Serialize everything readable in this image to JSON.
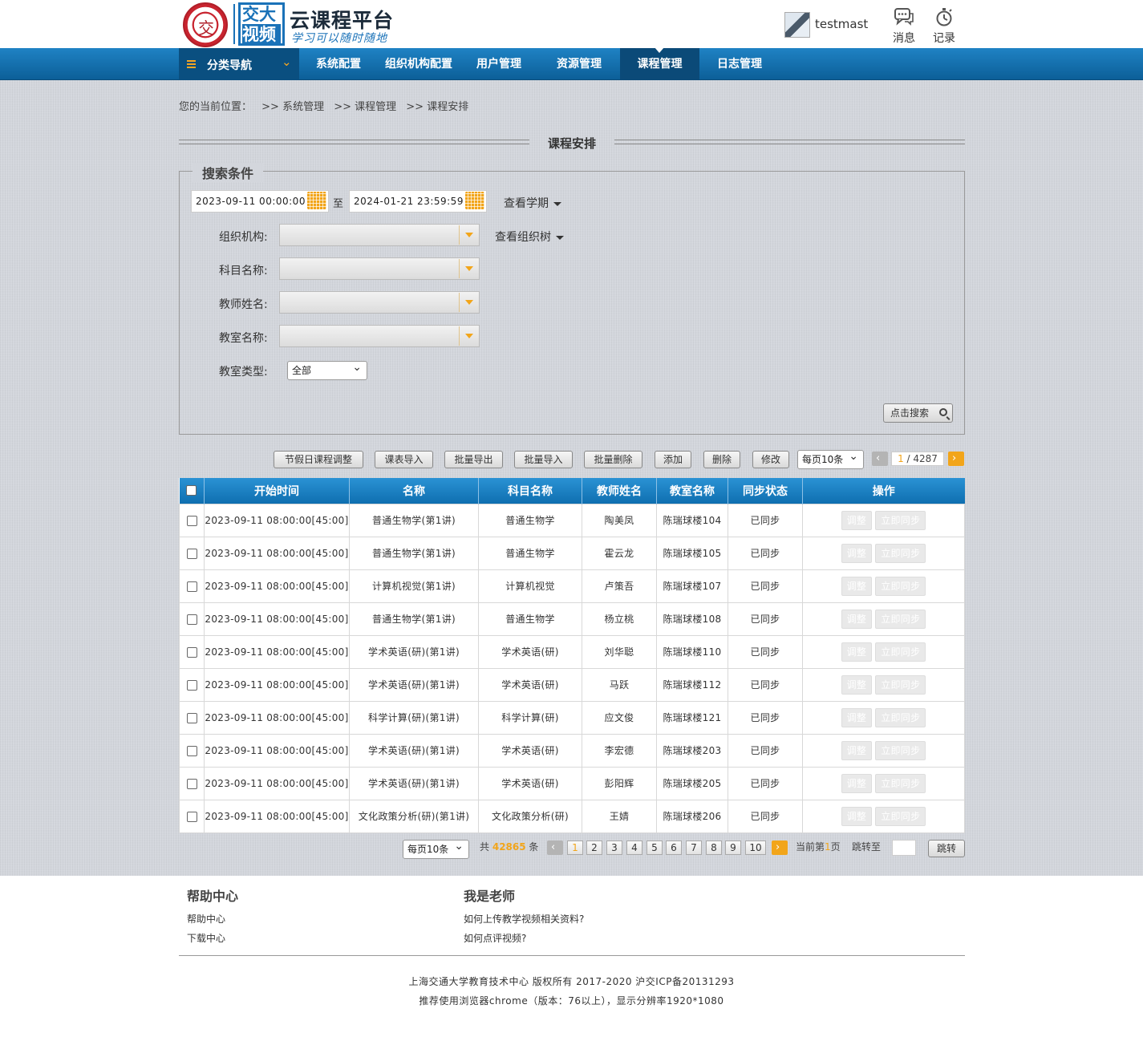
{
  "header": {
    "seal_glyph": "交",
    "logo_top": "交大",
    "logo_bottom": "视频",
    "title": "云课程平台",
    "subtitle": "学习可以随时随地",
    "username": "testmast",
    "messages_label": "消息",
    "records_label": "记录"
  },
  "nav": {
    "category_label": "分类导航",
    "items": [
      {
        "label": "系统配置"
      },
      {
        "label": "组织机构配置"
      },
      {
        "label": "用户管理"
      },
      {
        "label": "资源管理"
      },
      {
        "label": "课程管理",
        "active": true
      },
      {
        "label": "日志管理"
      }
    ]
  },
  "breadcrumb": {
    "prefix": "您的当前位置：",
    "items": [
      ">> 系统管理",
      ">> 课程管理",
      ">> 课程安排"
    ]
  },
  "page_title": "课程安排",
  "search": {
    "legend": "搜索条件",
    "start_date": "2023-09-11 00:00:00",
    "to_label": "至",
    "end_date": "2024-01-21 23:59:59",
    "view_term": "查看学期",
    "view_org_tree": "查看组织树",
    "org_label": "组织机构:",
    "subject_label": "科目名称:",
    "teacher_label": "教师姓名:",
    "room_label": "教室名称:",
    "room_type_label": "教室类型:",
    "room_type_value": "全部",
    "search_button": "点击搜索"
  },
  "toolbar": {
    "holiday_adjust": "节假日课程调整",
    "import_schedule": "课表导入",
    "batch_export": "批量导出",
    "batch_import": "批量导入",
    "batch_delete": "批量删除",
    "add": "添加",
    "delete": "删除",
    "edit": "修改",
    "page_size": "每页10条",
    "page_current": "1",
    "page_total": " / 4287"
  },
  "table": {
    "columns": [
      "开始时间",
      "名称",
      "科目名称",
      "教师姓名",
      "教室名称",
      "同步状态",
      "操作"
    ],
    "adjust_label": "调整",
    "sync_label": "立即同步",
    "rows": [
      {
        "start": "2023-09-11 08:00:00[45:00]",
        "name": "普通生物学(第1讲)",
        "subject": "普通生物学",
        "teacher": "陶美凤",
        "room": "陈瑞球楼104",
        "status": "已同步"
      },
      {
        "start": "2023-09-11 08:00:00[45:00]",
        "name": "普通生物学(第1讲)",
        "subject": "普通生物学",
        "teacher": "霍云龙",
        "room": "陈瑞球楼105",
        "status": "已同步"
      },
      {
        "start": "2023-09-11 08:00:00[45:00]",
        "name": "计算机视觉(第1讲)",
        "subject": "计算机视觉",
        "teacher": "卢策吾",
        "room": "陈瑞球楼107",
        "status": "已同步"
      },
      {
        "start": "2023-09-11 08:00:00[45:00]",
        "name": "普通生物学(第1讲)",
        "subject": "普通生物学",
        "teacher": "杨立桃",
        "room": "陈瑞球楼108",
        "status": "已同步"
      },
      {
        "start": "2023-09-11 08:00:00[45:00]",
        "name": "学术英语(研)(第1讲)",
        "subject": "学术英语(研)",
        "teacher": "刘华聪",
        "room": "陈瑞球楼110",
        "status": "已同步"
      },
      {
        "start": "2023-09-11 08:00:00[45:00]",
        "name": "学术英语(研)(第1讲)",
        "subject": "学术英语(研)",
        "teacher": "马跃",
        "room": "陈瑞球楼112",
        "status": "已同步"
      },
      {
        "start": "2023-09-11 08:00:00[45:00]",
        "name": "科学计算(研)(第1讲)",
        "subject": "科学计算(研)",
        "teacher": "应文俊",
        "room": "陈瑞球楼121",
        "status": "已同步"
      },
      {
        "start": "2023-09-11 08:00:00[45:00]",
        "name": "学术英语(研)(第1讲)",
        "subject": "学术英语(研)",
        "teacher": "李宏德",
        "room": "陈瑞球楼203",
        "status": "已同步"
      },
      {
        "start": "2023-09-11 08:00:00[45:00]",
        "name": "学术英语(研)(第1讲)",
        "subject": "学术英语(研)",
        "teacher": "彭阳辉",
        "room": "陈瑞球楼205",
        "status": "已同步"
      },
      {
        "start": "2023-09-11 08:00:00[45:00]",
        "name": "文化政策分析(研)(第1讲)",
        "subject": "文化政策分析(研)",
        "teacher": "王婧",
        "room": "陈瑞球楼206",
        "status": "已同步"
      }
    ]
  },
  "pager": {
    "page_size": "每页10条",
    "total_prefix": "共",
    "total": "42865",
    "total_suffix": "条",
    "pages": [
      "1",
      "2",
      "3",
      "4",
      "5",
      "6",
      "7",
      "8",
      "9",
      "10"
    ],
    "current_prefix": "当前第",
    "current": "1",
    "current_suffix": "页",
    "jump_label": "跳转至",
    "jump_button": "跳转"
  },
  "footer": {
    "help_heading": "帮助中心",
    "help_links": [
      "帮助中心",
      "下载中心"
    ],
    "teacher_heading": "我是老师",
    "teacher_links": [
      "如何上传教学视频相关资料?",
      "如何点评视频?"
    ],
    "copyright": "上海交通大学教育技术中心 版权所有 2017-2020 沪交ICP备20131293",
    "browser_note": "推荐使用浏览器chrome（版本：76以上），显示分辨率1920*1080"
  },
  "colors": {
    "nav_blue": "#0c5f98",
    "accent_orange": "#f2a51a",
    "table_header": "#1a7fc1",
    "page_bg": "#d3d6dc"
  }
}
